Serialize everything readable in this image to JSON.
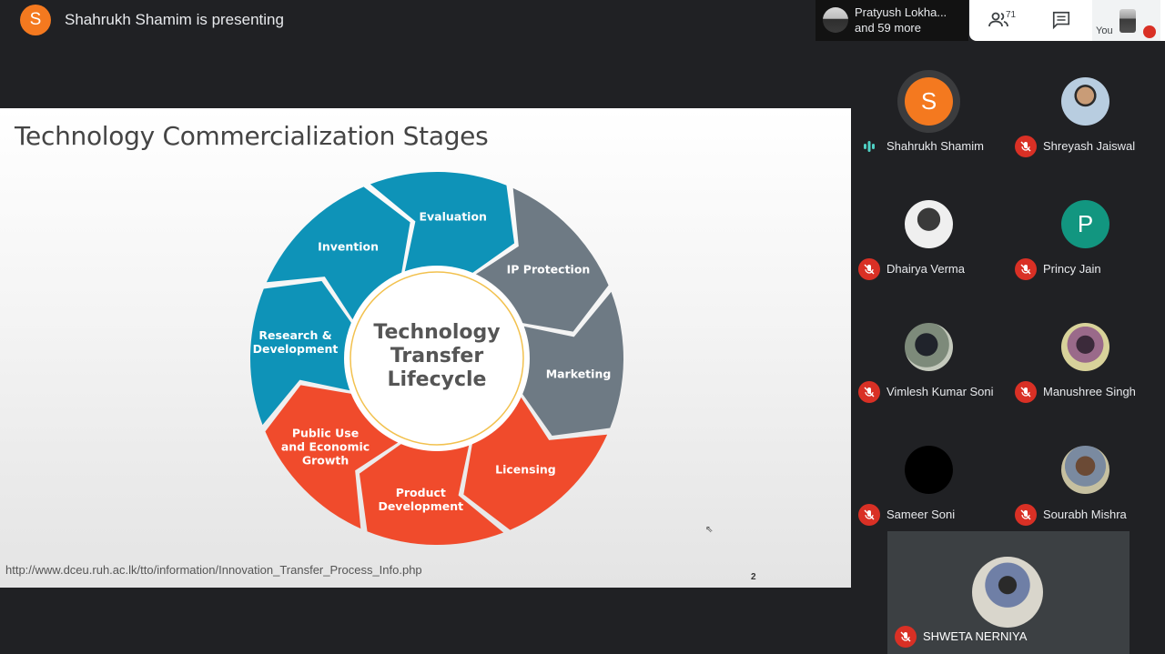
{
  "presenter": {
    "initial": "S",
    "text": "Shahrukh Shamim is presenting"
  },
  "top_participants": {
    "line1": "Pratyush Lokha...",
    "line2": "and 59 more"
  },
  "controls": {
    "people_count": "71",
    "self_label": "You"
  },
  "slide": {
    "title": "Technology Commercialization Stages",
    "center_text": [
      "Technology",
      "Transfer",
      "Lifecycle"
    ],
    "stages": [
      {
        "label": [
          "Research &",
          "Development"
        ],
        "color": "#0e93b8"
      },
      {
        "label": [
          "Invention"
        ],
        "color": "#0e93b8"
      },
      {
        "label": [
          "Evaluation"
        ],
        "color": "#0e93b8"
      },
      {
        "label": [
          "IP Protection"
        ],
        "color": "#6e7a84"
      },
      {
        "label": [
          "Marketing"
        ],
        "color": "#6e7a84"
      },
      {
        "label": [
          "Licensing"
        ],
        "color": "#f04b2c"
      },
      {
        "label": [
          "Product",
          "Development"
        ],
        "color": "#f04b2c"
      },
      {
        "label": [
          "Public Use",
          "and Economic",
          "Growth"
        ],
        "color": "#f04b2c"
      }
    ],
    "url": "http://www.dceu.ruh.ac.lk/tto/information/Innovation_Transfer_Process_Info.php",
    "page_number": "2"
  },
  "participants": [
    {
      "name": "Shahrukh Shamim",
      "initial": "S",
      "avatar_color": "#f4791f",
      "speaking": true
    },
    {
      "name": "Shreyash Jaiswal",
      "initial": "",
      "muted": true
    },
    {
      "name": "Dhairya Verma",
      "initial": "",
      "muted": true
    },
    {
      "name": "Princy Jain",
      "initial": "P",
      "avatar_color": "#129680",
      "muted": true
    },
    {
      "name": "Vimlesh Kumar Soni",
      "initial": "",
      "muted": true
    },
    {
      "name": "Manushree Singh",
      "initial": "",
      "muted": true
    },
    {
      "name": "Sameer Soni",
      "initial": "",
      "muted": true
    },
    {
      "name": "Sourabh Mishra",
      "initial": "",
      "muted": true
    }
  ],
  "bottom_participant": {
    "name": "SHWETA NERNIYA",
    "muted": true
  }
}
